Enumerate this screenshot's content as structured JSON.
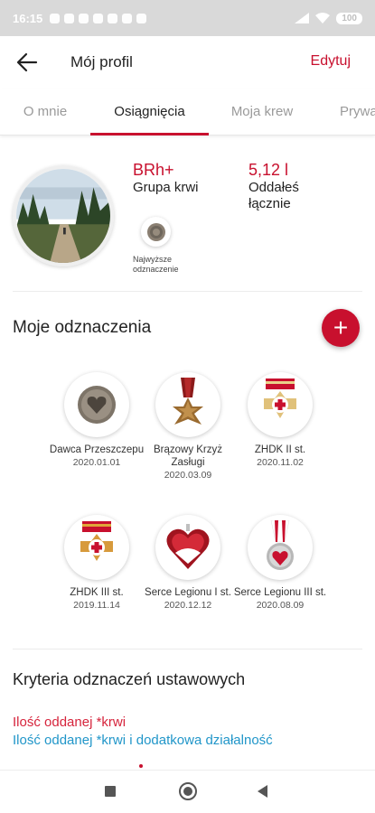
{
  "status_bar": {
    "time": "16:15",
    "battery": "100"
  },
  "header": {
    "title": "Mój profil",
    "edit_label": "Edytuj"
  },
  "tabs": [
    {
      "label": "O mnie",
      "active": false
    },
    {
      "label": "Osiągnięcia",
      "active": true
    },
    {
      "label": "Moja krew",
      "active": false
    },
    {
      "label": "Prywa",
      "active": false
    }
  ],
  "profile": {
    "blood_type": "BRh+",
    "blood_type_label": "Grupa krwi",
    "donated_amount": "5,12 l",
    "donated_label": "Oddałeś łącznie",
    "top_badge_label": "Najwyższe odznaczenie"
  },
  "badges_section": {
    "title": "Moje odznaczenia",
    "add_icon": "plus-icon"
  },
  "badges": [
    {
      "name": "Dawca Przeszczepu",
      "date": "2020.01.01",
      "icon": "heart-medal"
    },
    {
      "name": "Brązowy Krzyż Zasługi",
      "date": "2020.03.09",
      "icon": "bronze-cross"
    },
    {
      "name": "ZHDK II st.",
      "date": "2020.11.02",
      "icon": "zhdk-cross-2"
    },
    {
      "name": "ZHDK III st.",
      "date": "2019.11.14",
      "icon": "zhdk-cross-3"
    },
    {
      "name": "Serce Legionu I st.",
      "date": "2020.12.12",
      "icon": "heart-legion-1"
    },
    {
      "name": "Serce Legionu III st.",
      "date": "2020.08.09",
      "icon": "heart-legion-3"
    }
  ],
  "criteria": {
    "title": "Kryteria odznaczeń ustawowych",
    "link1": "Ilość oddanej *krwi",
    "link2": "Ilość oddanej *krwi i dodatkowa działalność"
  },
  "colors": {
    "accent": "#c8102e",
    "link_blue": "#2196c9",
    "link_pink": "#d6243c"
  }
}
